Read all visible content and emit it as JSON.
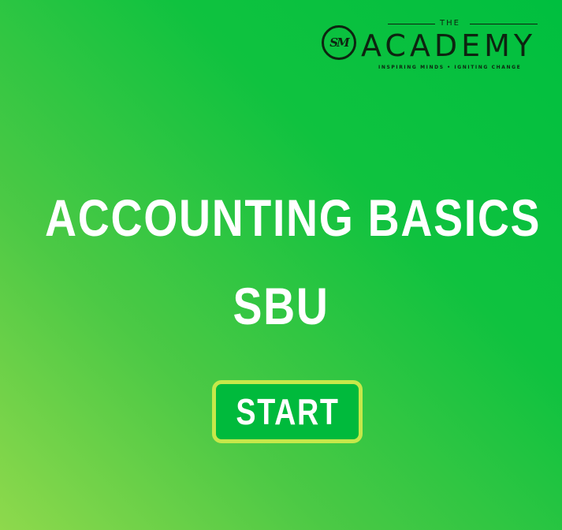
{
  "logo": {
    "badge_text": "SM",
    "the_text": "THE",
    "wordmark": "ACADEMY",
    "tagline": "INSPIRING MINDS • IGNITING CHANGE"
  },
  "title": {
    "line1": "ACCOUNTING BASICS",
    "line2": "SBU"
  },
  "start_button": {
    "label": "START"
  },
  "colors": {
    "background_start": "#00bf3f",
    "background_end": "#8ed94c",
    "button_fill": "#00ba3c",
    "button_border": "#c6e84a",
    "text": "#ffffff",
    "logo_dark": "#0d2410"
  }
}
